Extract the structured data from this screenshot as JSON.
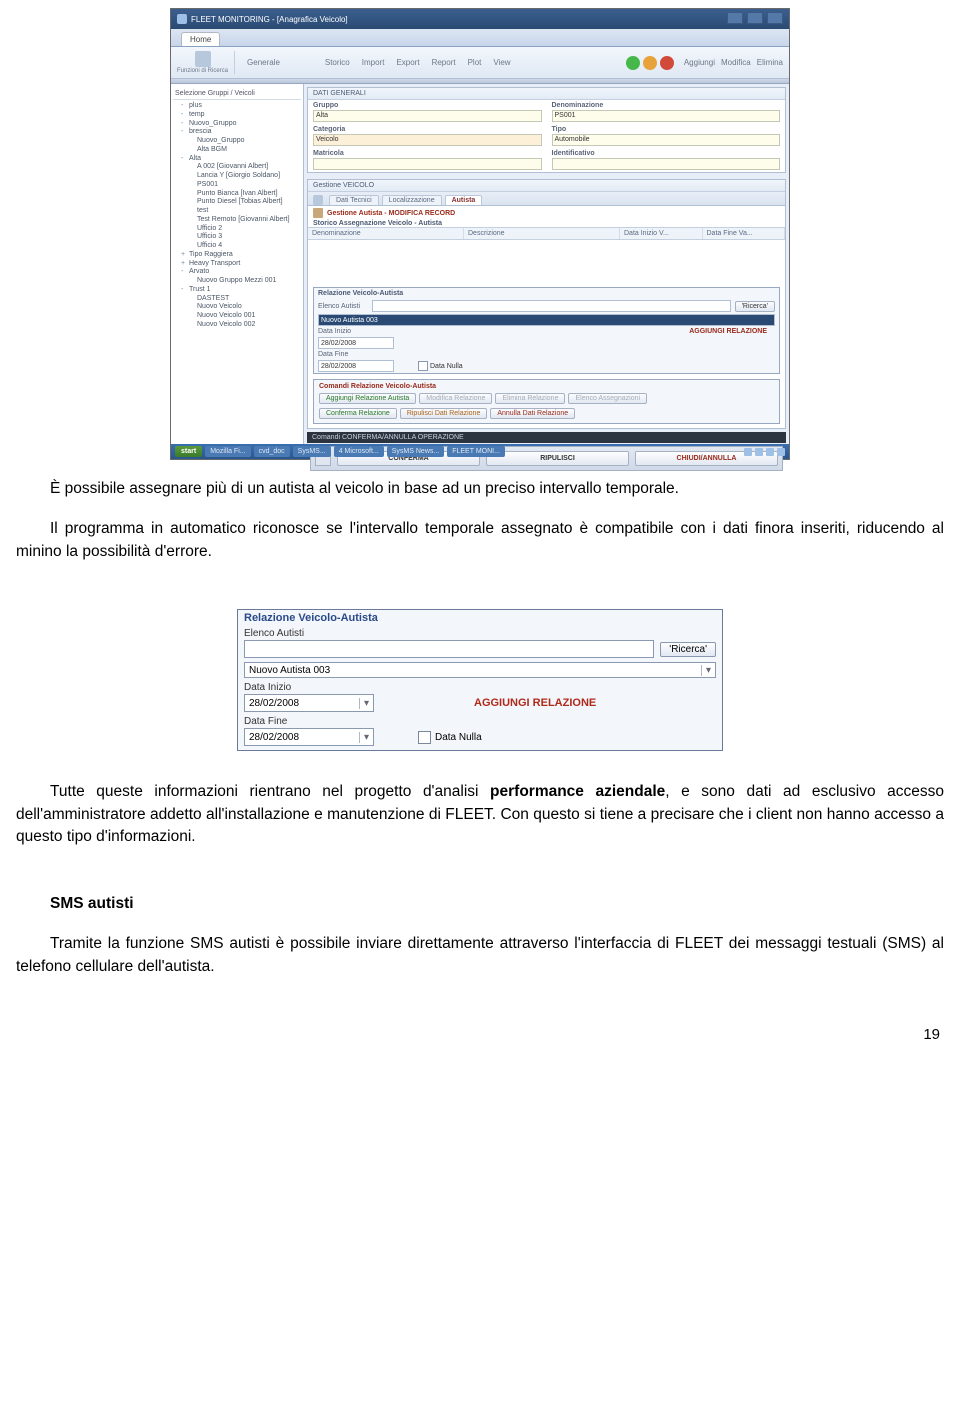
{
  "app": {
    "title": "FLEET MONITORING - [Anagrafica Veicolo]",
    "home_tab": "Home",
    "tool_left_label": "Funzioni di Ricerca",
    "tool_buttons": [
      "Generale",
      "",
      "",
      "Storico",
      "Import",
      "Export",
      "Report",
      "Plot",
      "View"
    ],
    "tool_action_labels": [
      "Aggiungi",
      "Modifica",
      "Elimina"
    ],
    "sidebar_title": "Selezione Gruppi / Veicoli",
    "tree": [
      {
        "lvl": 0,
        "exp": "-",
        "label": "plus"
      },
      {
        "lvl": 0,
        "exp": "-",
        "label": "temp"
      },
      {
        "lvl": 0,
        "exp": "-",
        "label": "Nuovo_Gruppo"
      },
      {
        "lvl": 0,
        "exp": "-",
        "label": "brescia"
      },
      {
        "lvl": 1,
        "exp": "",
        "label": "Nuovo_Gruppo"
      },
      {
        "lvl": 1,
        "exp": "",
        "label": "Alta BGM"
      },
      {
        "lvl": 0,
        "exp": "-",
        "label": "Alta"
      },
      {
        "lvl": 1,
        "exp": "",
        "label": "A 002 [Giovanni Albert]"
      },
      {
        "lvl": 1,
        "exp": "",
        "label": "Lancia Y [Giorgio Soldano]"
      },
      {
        "lvl": 1,
        "exp": "",
        "label": "PS001"
      },
      {
        "lvl": 1,
        "exp": "",
        "label": "Punto Bianca [Ivan Albert]"
      },
      {
        "lvl": 1,
        "exp": "",
        "label": "Punto Diesel [Tobias Albert]"
      },
      {
        "lvl": 1,
        "exp": "",
        "label": "test"
      },
      {
        "lvl": 1,
        "exp": "",
        "label": "Test Remoto [Giovanni Albert]"
      },
      {
        "lvl": 1,
        "exp": "",
        "label": "Ufficio 2"
      },
      {
        "lvl": 1,
        "exp": "",
        "label": "Ufficio 3"
      },
      {
        "lvl": 1,
        "exp": "",
        "label": "Ufficio 4"
      },
      {
        "lvl": 0,
        "exp": "+",
        "label": "Tipo Raggiera"
      },
      {
        "lvl": 0,
        "exp": "+",
        "label": "Heavy Transport"
      },
      {
        "lvl": 0,
        "exp": "-",
        "label": "Arvato"
      },
      {
        "lvl": 1,
        "exp": "",
        "label": "Nuovo Gruppo Mezzi 001"
      },
      {
        "lvl": 0,
        "exp": "-",
        "label": "Trust 1"
      },
      {
        "lvl": 1,
        "exp": "",
        "label": "DASTEST"
      },
      {
        "lvl": 1,
        "exp": "",
        "label": "Nuovo Veicolo"
      },
      {
        "lvl": 1,
        "exp": "",
        "label": "Nuovo Veicolo 001"
      },
      {
        "lvl": 1,
        "exp": "",
        "label": "Nuovo Veicolo 002"
      }
    ],
    "panel1": {
      "title": "DATI GENERALI",
      "fields_left": [
        {
          "label": "Gruppo",
          "value": "Alta"
        },
        {
          "label": "Categoria",
          "value": "Veicolo"
        },
        {
          "label": "Matricola",
          "value": ""
        }
      ],
      "fields_right": [
        {
          "label": "Denominazione",
          "value": "PS001"
        },
        {
          "label": "Tipo",
          "value": "Automobile"
        },
        {
          "label": "Identificativo",
          "value": ""
        }
      ]
    },
    "panel2": {
      "title": "Gestione VEICOLO",
      "tabs": [
        "Dati Tecnici",
        "Localizzazione",
        "Autista"
      ],
      "active_tab": 2,
      "red_header": "Gestione Autista - MODIFICA RECORD",
      "table_title": "Storico Assegnazione Veicolo - Autista",
      "table_cols": [
        "Denominazione",
        "Descrizione",
        "Data Inizio V...",
        "Data Fine Va..."
      ]
    },
    "rel": {
      "title": "Relazione Veicolo-Autista",
      "elenco_label": "Elenco Autisti",
      "search_btn": "'Ricerca'",
      "selected": "Nuovo Autista 003",
      "data_inizio_label": "Data Inizio",
      "data_inizio": "28/02/2008",
      "data_fine_label": "Data Fine",
      "data_fine": "28/02/2008",
      "data_nulla": "Data Nulla",
      "action": "AGGIUNGI RELAZIONE"
    },
    "cmd": {
      "title": "Comandi Relazione Veicolo-Autista",
      "row1": [
        "Aggiungi Relazione Autista",
        "Modifica Relazione",
        "Elimina Relazione",
        "Elenco Assegnazioni"
      ],
      "row2": [
        "Conferma Relazione",
        "Ripulisci Dati Relazione",
        "Annulla Dati Relazione"
      ]
    },
    "footer": {
      "dark_title": "Comandi CONFERMA/ANNULLA OPERAZIONE",
      "buttons": [
        "CONFERMA",
        "RIPULISCI",
        "CHIUDI/ANNULLA"
      ]
    },
    "taskbar": {
      "start": "start",
      "items": [
        "Mozilla Fi...",
        "cvd_doc",
        "",
        "SysMS...",
        "",
        "4 Microsoft...",
        "",
        "SysMS News...",
        "",
        "FLEET MONI..."
      ]
    }
  },
  "inset": {
    "title": "Relazione Veicolo-Autista",
    "elenco_label": "Elenco Autisti",
    "search_btn": "'Ricerca'",
    "select_value": "Nuovo Autista 003",
    "data_inizio_label": "Data Inizio",
    "data_inizio": "28/02/2008",
    "data_fine_label": "Data Fine",
    "data_fine": "28/02/2008",
    "action": "AGGIUNGI RELAZIONE",
    "checkbox": "Data Nulla"
  },
  "text": {
    "p1": "È possibile assegnare più di un autista al veicolo in base ad un preciso intervallo temporale.",
    "p2": "Il programma in automatico riconosce se l'intervallo temporale assegnato è compatibile con i dati finora inseriti, riducendo al minino la possibilità d'errore.",
    "p3a": "Tutte queste informazioni rientrano nel progetto d'analisi ",
    "p3b": "performance aziendale",
    "p3c": ", e sono dati ad esclusivo accesso dell'amministratore addetto all'installazione e manutenzione di FLEET. Con questo si tiene a precisare che i client non hanno accesso a questo tipo d'informazioni.",
    "h1": "SMS autisti",
    "p4": "Tramite la funzione SMS autisti è possibile inviare direttamente attraverso l'interfaccia di FLEET dei messaggi testuali (SMS) al telefono cellulare dell'autista.",
    "page_num": "19"
  }
}
